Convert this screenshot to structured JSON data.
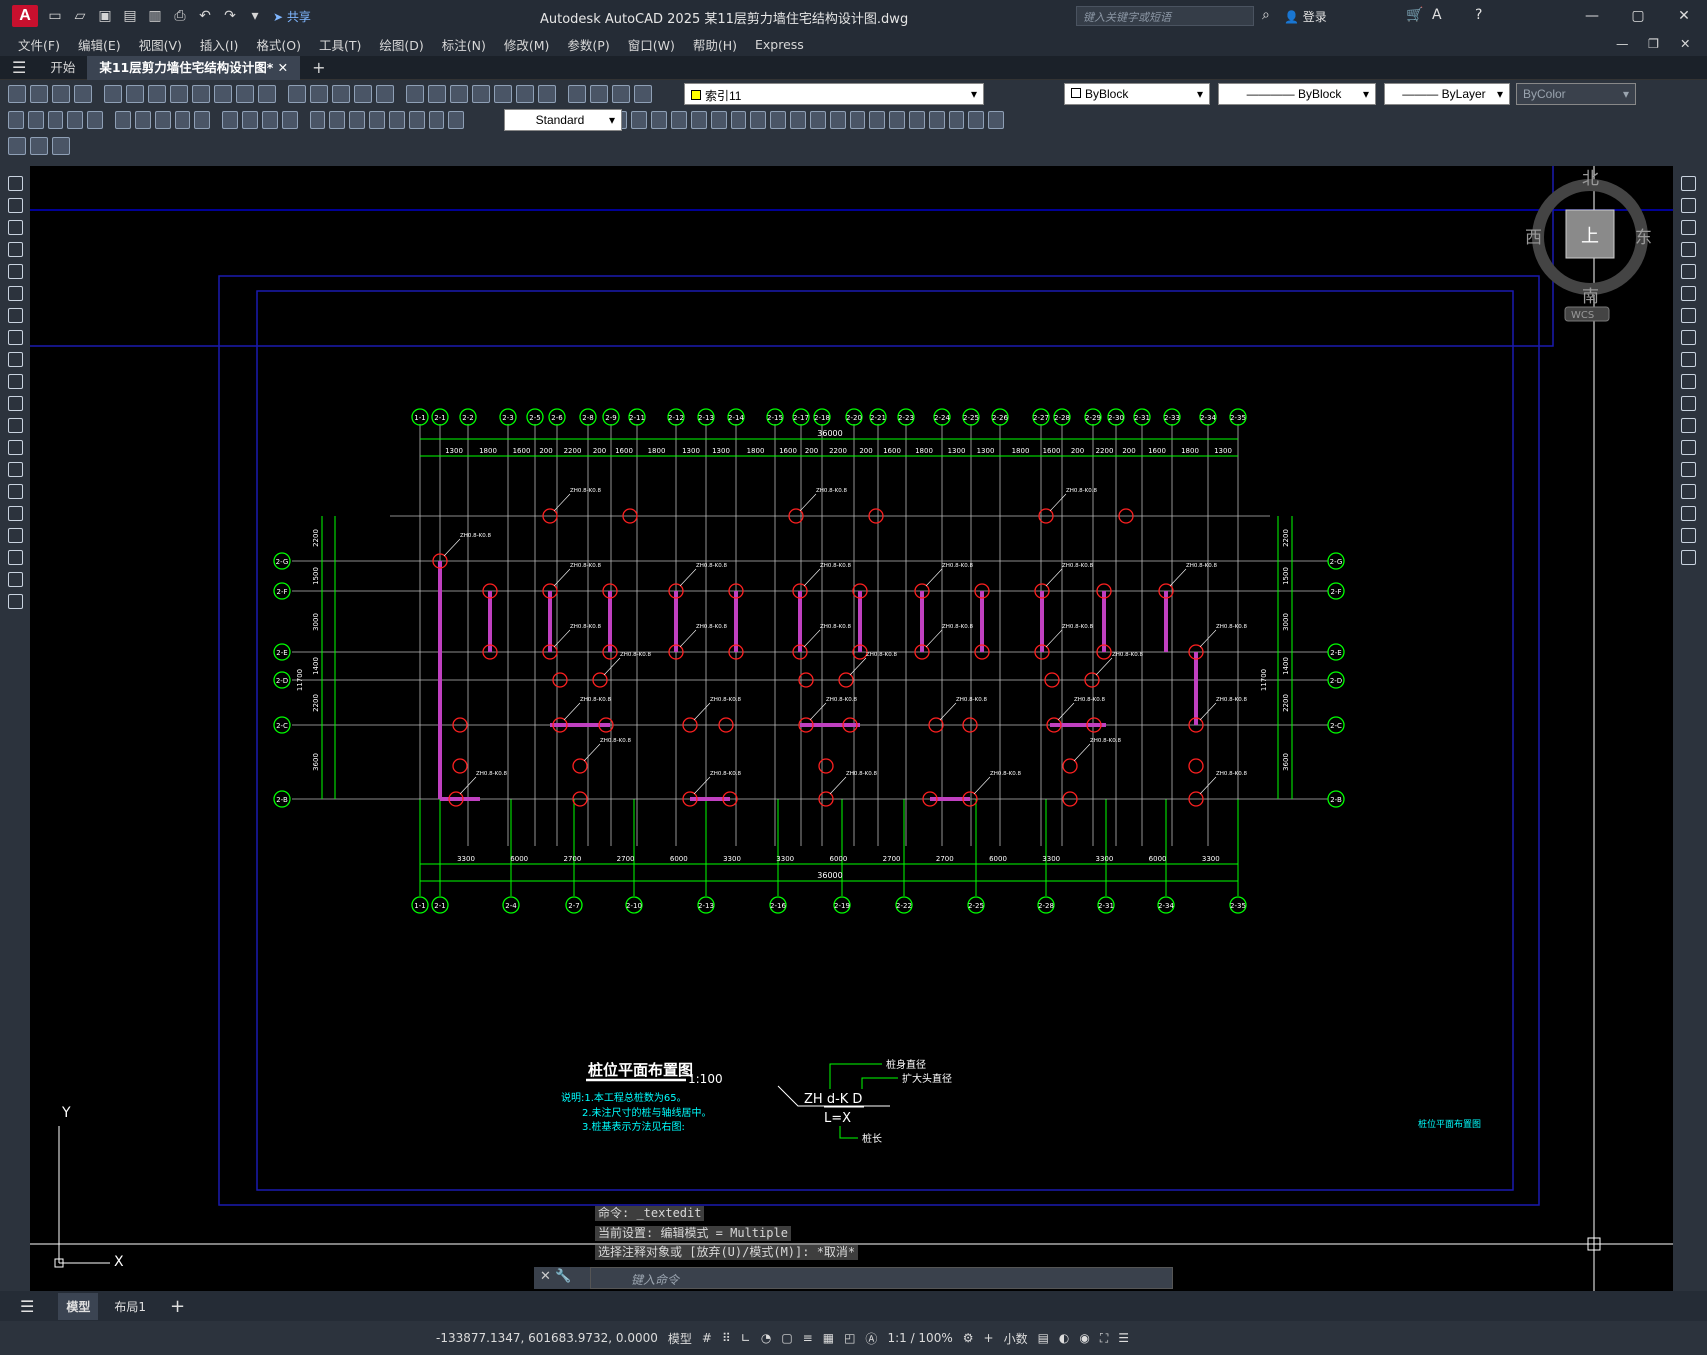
{
  "titlebar": {
    "logo": "A",
    "share": "共享",
    "title": "Autodesk AutoCAD 2025    某11层剪力墙住宅结构设计图.dwg",
    "search_placeholder": "键入关键字或短语",
    "login": "登录",
    "icons": [
      "new-icon",
      "open-icon",
      "save-icon",
      "saveas-icon",
      "plot-icon",
      "undo-icon",
      "redo-icon"
    ]
  },
  "menu": [
    "文件(F)",
    "编辑(E)",
    "视图(V)",
    "插入(I)",
    "格式(O)",
    "工具(T)",
    "绘图(D)",
    "标注(N)",
    "修改(M)",
    "参数(P)",
    "窗口(W)",
    "帮助(H)",
    "Express"
  ],
  "doctabs": {
    "start": "开始",
    "active": "某11层剪力墙住宅结构设计图*",
    "add": "+"
  },
  "toolbar": {
    "textstyle": "Standard",
    "layer": "索引11",
    "color": "ByBlock",
    "linetype": "ByBlock",
    "lineweight": "ByLayer",
    "plotstyle": "ByColor"
  },
  "viewcube": {
    "north": "北",
    "south": "南",
    "east": "东",
    "west": "西",
    "top": "上",
    "wcs": "WCS"
  },
  "ucs": {
    "y": "Y",
    "x": "X"
  },
  "drawing": {
    "top_axes": [
      "1-1",
      "2-1",
      "2-2",
      "2-3",
      "2-5",
      "2-6",
      "2-8",
      "2-9",
      "2-11",
      "2-12",
      "2-13",
      "2-14",
      "2-15",
      "2-17",
      "2-18",
      "2-20",
      "2-21",
      "2-23",
      "2-24",
      "2-25",
      "2-26",
      "2-27",
      "2-28",
      "2-29",
      "2-30",
      "2-31",
      "2-33",
      "2-34",
      "2-35"
    ],
    "bottom_axes": [
      "1-1",
      "2-1",
      "2-4",
      "2-7",
      "2-10",
      "2-13",
      "2-16",
      "2-19",
      "2-22",
      "2-25",
      "2-28",
      "2-31",
      "2-34",
      "2-35"
    ],
    "left_axes": [
      "2-G",
      "2-F",
      "2-E",
      "2-D",
      "2-C",
      "2-B"
    ],
    "top_total": "36000",
    "bottom_total": "36000",
    "top_dims": [
      "1300",
      "1800",
      "1600",
      "200",
      "2200",
      "200",
      "1600",
      "1800",
      "1300",
      "1300",
      "1800",
      "1600",
      "200",
      "2200",
      "200",
      "1600",
      "1800",
      "1300",
      "1300",
      "1800",
      "1600",
      "200",
      "2200",
      "200",
      "1600",
      "1800",
      "1300"
    ],
    "bottom_dims": [
      "3300",
      "6000",
      "2700",
      "2700",
      "6000",
      "3300",
      "3300",
      "6000",
      "2700",
      "2700",
      "6000",
      "3300",
      "3300",
      "6000",
      "3300"
    ],
    "side_dims": [
      "2200",
      "1500",
      "3000",
      "1400",
      "2200",
      "3600"
    ],
    "side_total": "11700",
    "pile_label": "ZH0.8-K0.8",
    "title": "桩位平面布置图",
    "scale": "1:100",
    "notes": [
      "说明:1.本工程总桩数为65。",
      "2.未注尺寸的桩与轴线居中。",
      "3.桩基表示方法见右图:"
    ],
    "legend": {
      "formula": "ZH d-K D",
      "length": "L=X",
      "l1": "桩身直径",
      "l2": "扩大头直径",
      "l3": "桩长"
    },
    "frame_label": "桩位平面布置图"
  },
  "commands": [
    "命令: _textedit",
    "当前设置: 编辑模式 = Multiple",
    "选择注释对象或 [放弃(U)/模式(M)]: *取消*"
  ],
  "cmd_placeholder": "键入命令",
  "layout_tabs": [
    "模型",
    "布局1"
  ],
  "status": {
    "coords": "-133877.1347, 601683.9732, 0.0000",
    "model": "模型",
    "scale": "1:1 / 100%",
    "units": "小数"
  }
}
